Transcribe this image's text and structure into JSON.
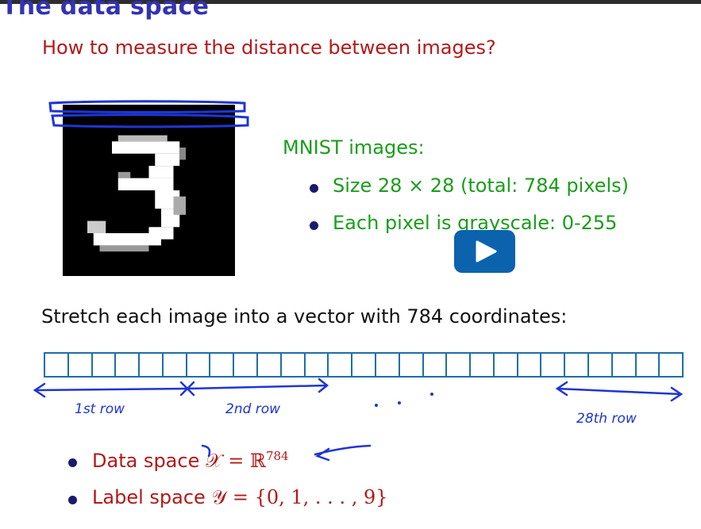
{
  "slide": {
    "title": "The data space",
    "subtitle": "How to measure the distance between images?",
    "mnist": {
      "heading": "MNIST images:",
      "items": [
        "Size 28 × 28 (total: 784 pixels)",
        "Each pixel is grayscale: 0-255"
      ]
    },
    "stretch_text": "Stretch each image into a vector with 784 coordinates:",
    "vector": {
      "cells": 27,
      "border_color": "#1d6fa8"
    },
    "annotations": {
      "first_row": "1st row",
      "second_row": "2nd row",
      "last_row": "28th row",
      "dots": ". . ."
    },
    "bottom": {
      "data_space_label": "Data space",
      "data_space_math": "𝒳 = ℝ",
      "data_space_exp": "784",
      "label_space_label": "Label space",
      "label_space_math": "𝒴 = {0, 1, . . . , 9}"
    }
  },
  "player": {
    "icon": "play-icon",
    "color": "#0b63ad"
  },
  "colors": {
    "title": "#3333b3",
    "subtitle": "#b31919",
    "mnist_text": "#1a9d1a",
    "ink": "#1f35d6"
  }
}
